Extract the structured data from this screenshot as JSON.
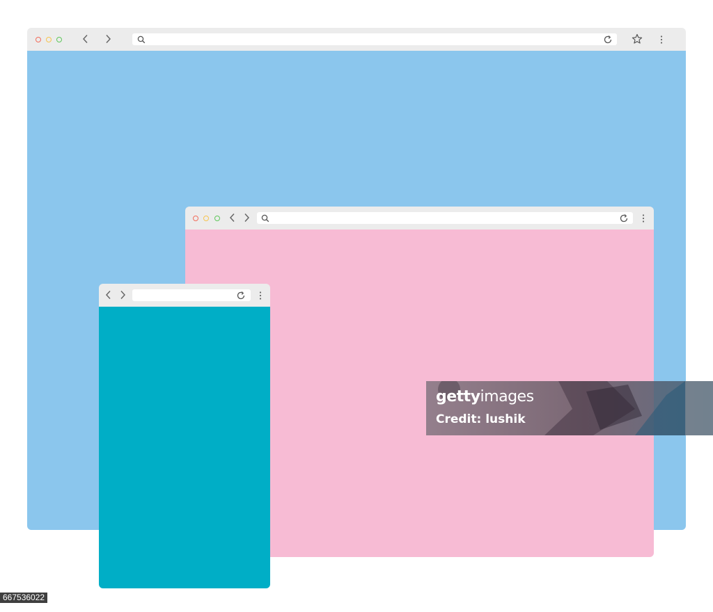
{
  "windows": {
    "desktop": {
      "content_color": "#8bc6ed",
      "traffic_lights": [
        "#f26d5b",
        "#f7c44f",
        "#5fc75b"
      ],
      "icons": [
        "back-chevron-icon",
        "forward-chevron-icon",
        "search-icon",
        "reload-icon",
        "star-icon",
        "kebab-menu-icon"
      ],
      "address_value": ""
    },
    "tablet": {
      "content_color": "#f7bbd4",
      "traffic_lights": [
        "#f26d5b",
        "#f7c44f",
        "#5fc75b"
      ],
      "icons": [
        "back-chevron-icon",
        "forward-chevron-icon",
        "search-icon",
        "reload-icon",
        "kebab-menu-icon"
      ],
      "address_value": ""
    },
    "mobile": {
      "content_color": "#00aec6",
      "icons": [
        "back-chevron-icon",
        "forward-chevron-icon",
        "reload-icon",
        "kebab-menu-icon"
      ],
      "address_value": ""
    }
  },
  "toolbar_color": "#ececec",
  "watermark": {
    "brand_bold": "getty",
    "brand_light": "images",
    "credit": "Credit: lushik"
  },
  "image_id": "667536022"
}
